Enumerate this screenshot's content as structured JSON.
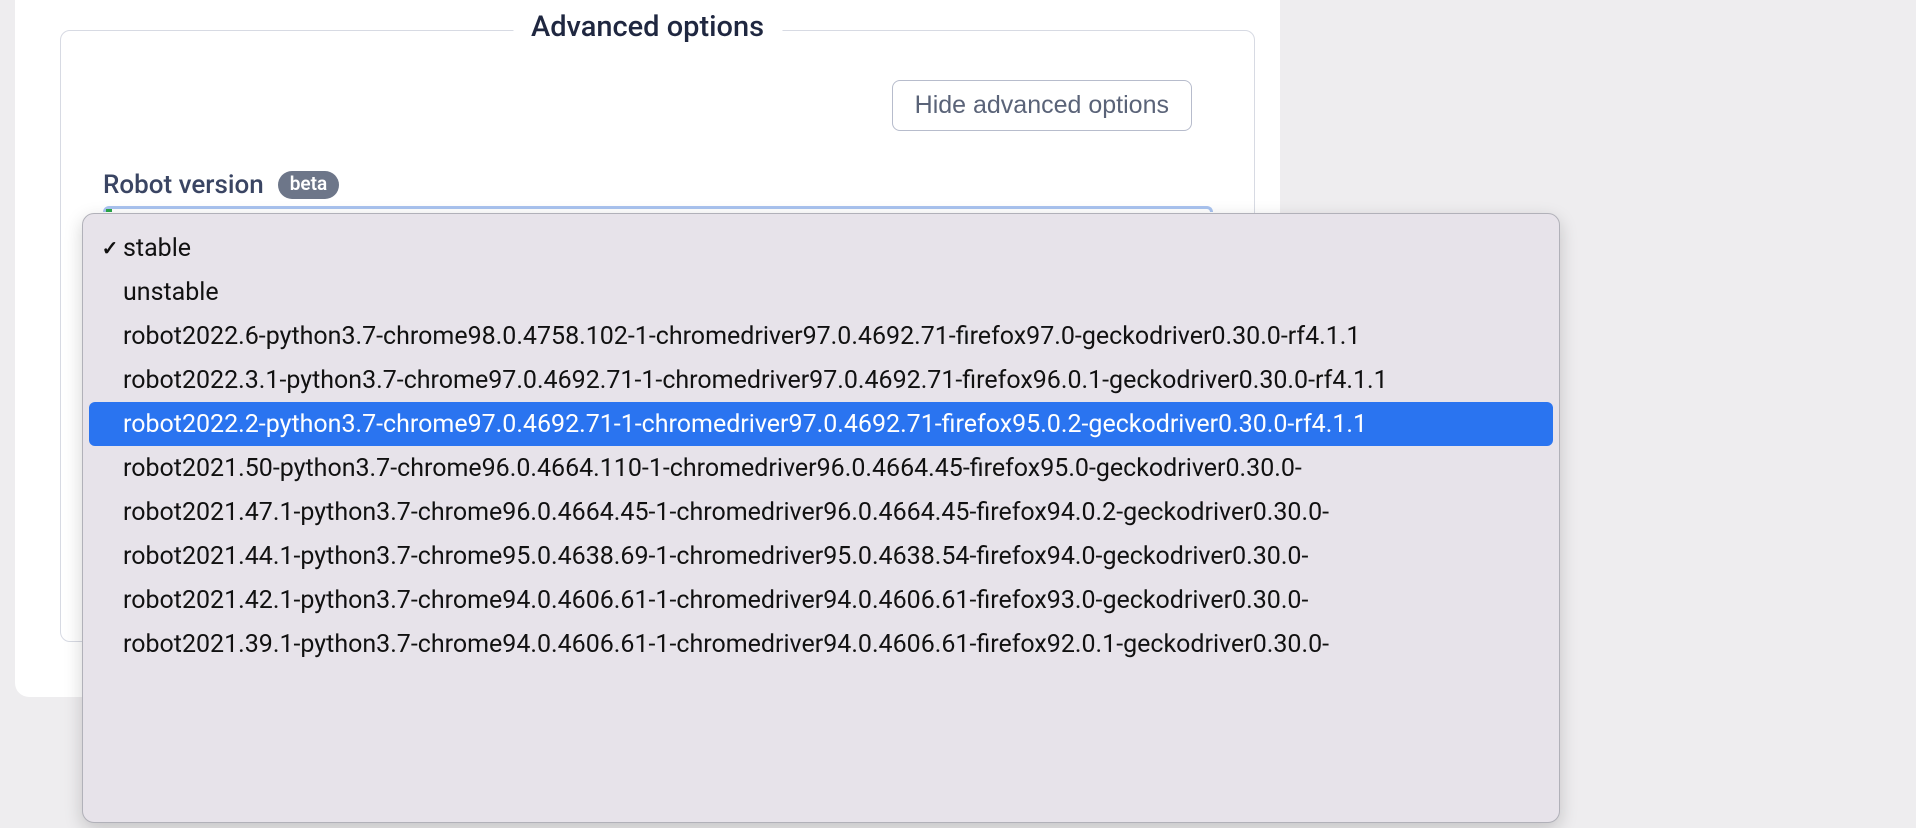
{
  "panel": {
    "legend": "Advanced options",
    "hide_button": "Hide advanced options"
  },
  "robot_version": {
    "label": "Robot version",
    "badge": "beta",
    "selected": "stable",
    "highlighted_index": 4,
    "options": [
      "stable",
      "unstable",
      "robot2022.6-python3.7-chrome98.0.4758.102-1-chromedriver97.0.4692.71-firefox97.0-geckodriver0.30.0-rf4.1.1",
      "robot2022.3.1-python3.7-chrome97.0.4692.71-1-chromedriver97.0.4692.71-firefox96.0.1-geckodriver0.30.0-rf4.1.1",
      "robot2022.2-python3.7-chrome97.0.4692.71-1-chromedriver97.0.4692.71-firefox95.0.2-geckodriver0.30.0-rf4.1.1",
      "robot2021.50-python3.7-chrome96.0.4664.110-1-chromedriver96.0.4664.45-firefox95.0-geckodriver0.30.0-",
      "robot2021.47.1-python3.7-chrome96.0.4664.45-1-chromedriver96.0.4664.45-firefox94.0.2-geckodriver0.30.0-",
      "robot2021.44.1-python3.7-chrome95.0.4638.69-1-chromedriver95.0.4638.54-firefox94.0-geckodriver0.30.0-",
      "robot2021.42.1-python3.7-chrome94.0.4606.61-1-chromedriver94.0.4606.61-firefox93.0-geckodriver0.30.0-",
      "robot2021.39.1-python3.7-chrome94.0.4606.61-1-chromedriver94.0.4606.61-firefox92.0.1-geckodriver0.30.0-"
    ]
  }
}
